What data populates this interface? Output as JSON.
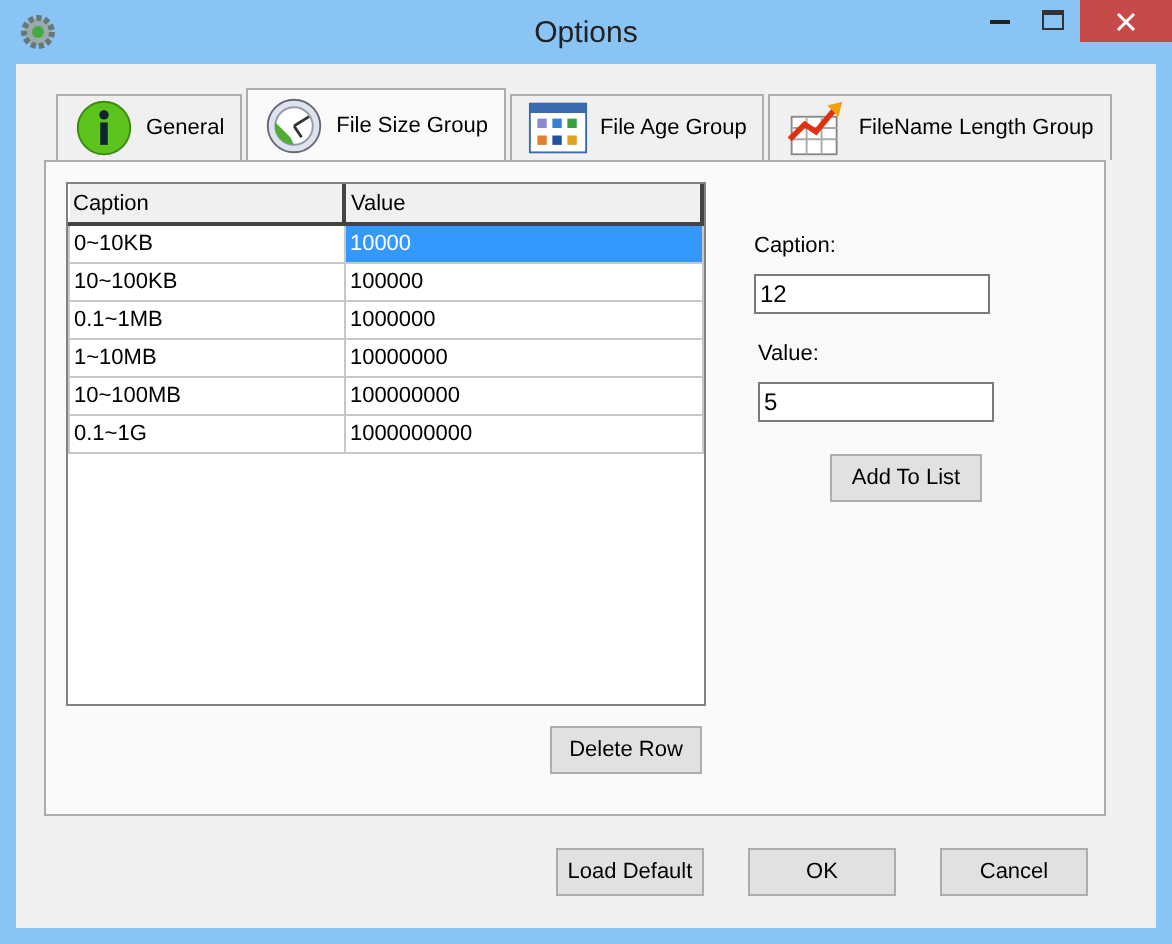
{
  "window": {
    "title": "Options"
  },
  "tabs": [
    {
      "label": "General",
      "selected": false,
      "kind": "info"
    },
    {
      "label": "File Size Group",
      "selected": true,
      "kind": "clock"
    },
    {
      "label": "File Age Group",
      "selected": false,
      "kind": "grid"
    },
    {
      "label": "FileName Length Group",
      "selected": false,
      "kind": "chart"
    }
  ],
  "table": {
    "columns": [
      "Caption",
      "Value"
    ],
    "rows": [
      {
        "cells": [
          "0~10KB",
          "10000"
        ],
        "selected": true
      },
      {
        "cells": [
          "10~100KB",
          "100000"
        ],
        "selected": false
      },
      {
        "cells": [
          "0.1~1MB",
          "1000000"
        ],
        "selected": false
      },
      {
        "cells": [
          "1~10MB",
          "10000000"
        ],
        "selected": false
      },
      {
        "cells": [
          "10~100MB",
          "100000000"
        ],
        "selected": false
      },
      {
        "cells": [
          "0.1~1G",
          "1000000000"
        ],
        "selected": false
      }
    ]
  },
  "delete_button": "Delete Row",
  "form": {
    "caption_label": "Caption:",
    "caption_value": "12",
    "value_label": "Value:",
    "value_value": "5",
    "add_button": "Add To List"
  },
  "buttons": [
    "Load Default",
    "OK",
    "Cancel"
  ]
}
